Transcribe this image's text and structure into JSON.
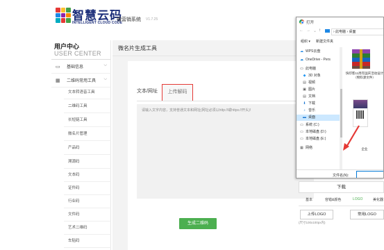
{
  "header": {
    "brand": "智慧云码",
    "brand_en": "INTELLIGENT CLOUD CODE",
    "system_name": "微营销系统",
    "version": "V1.7.25",
    "logo_colors": [
      "#e53935",
      "#fbc02d",
      "#43a047",
      "#1e88e5",
      "#8e24aa",
      "#fb8c00",
      "#00acc1",
      "#e53935",
      "#43a047"
    ]
  },
  "sidebar": {
    "user_center": "用户中心",
    "user_center_en": "USER CENTER",
    "groups": [
      {
        "icon": "monitor-icon",
        "label": "基础信息",
        "chevron": "⌵"
      },
      {
        "icon": "grid-icon",
        "label": "二维码常用工具",
        "chevron": "⌵"
      }
    ],
    "items": [
      "文本转语音工具",
      "二维码工具",
      "长短链工具",
      "微名片管理",
      "产品码",
      "溯源码",
      "文本码",
      "证件码",
      "行业码",
      "文件码",
      "艺术二维码",
      "车贴码"
    ]
  },
  "main": {
    "title": "微名片生成工具",
    "tab_text": "文本/网址",
    "tab_upload": "上传解码",
    "placeholder": "请输入文字内容，支持普通文本和网址(网址必须以http://或https://开头)!",
    "generate_button": "生成二维码"
  },
  "right_panel": {
    "download": "下载",
    "tabs": [
      "基本",
      "容错&颜色",
      "LOGO",
      "美化器"
    ],
    "active_tab": "LOGO",
    "upload_logo": "上传LOGO",
    "common_logo": "常用LOGO",
    "logo_note": "(尺寸100x100px内)"
  },
  "dialog": {
    "title": "打开",
    "address": "› 此电脑 › 桌面",
    "organize": "组织 ▾",
    "new_folder": "新建文件夹",
    "nav": [
      {
        "icon": "cloud-icon",
        "label": "WPS云盘",
        "color": "#1e88e5"
      },
      {
        "icon": "onedrive-icon",
        "label": "OneDrive - Pers",
        "color": "#0078d7"
      },
      {
        "icon": "pc-icon",
        "label": "此电脑",
        "color": "#333"
      },
      {
        "icon": "cube-icon",
        "label": "3D 对象",
        "color": "#2196f3"
      },
      {
        "icon": "video-icon",
        "label": "视频",
        "color": "#555"
      },
      {
        "icon": "picture-icon",
        "label": "图片",
        "color": "#555"
      },
      {
        "icon": "document-icon",
        "label": "文档",
        "color": "#555"
      },
      {
        "icon": "download-icon",
        "label": "下载",
        "color": "#1976d2"
      },
      {
        "icon": "music-icon",
        "label": "音乐",
        "color": "#1976d2"
      },
      {
        "icon": "desktop-icon",
        "label": "桌面",
        "color": "#1976d2",
        "selected": true
      },
      {
        "icon": "drive-icon",
        "label": "系统 (C:)",
        "color": "#555"
      },
      {
        "icon": "drive-icon",
        "label": "本地磁盘 (D:)",
        "color": "#555"
      },
      {
        "icon": "drive-icon",
        "label": "本地磁盘 (E:)",
        "color": "#555"
      },
      {
        "icon": "network-icon",
        "label": "网络",
        "color": "#555"
      }
    ],
    "files": [
      {
        "name": "快印客11周年国庆活动设计（物料源文件）"
      },
      {
        "name": "企业"
      }
    ],
    "filename_label": "文件名(N):",
    "filename_value": ""
  }
}
